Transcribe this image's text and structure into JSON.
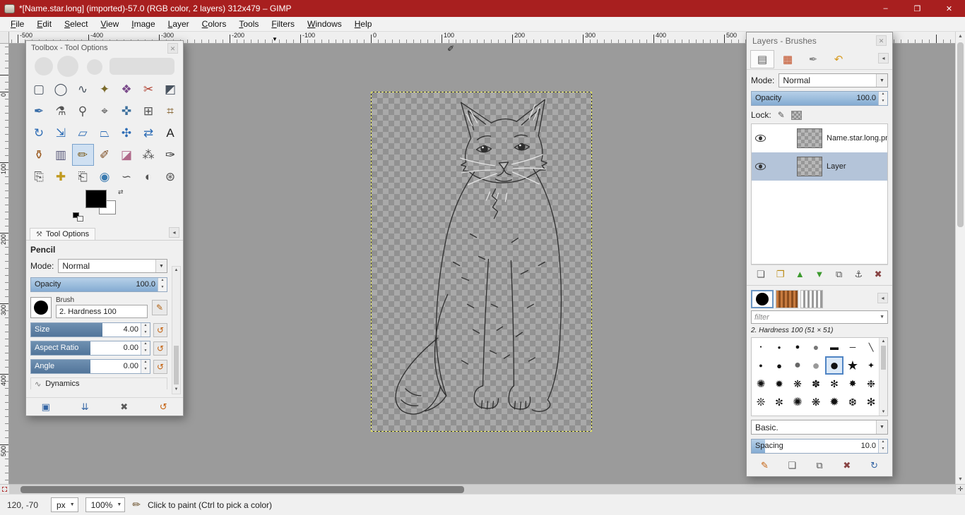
{
  "window": {
    "title": "*[Name.star.long] (imported)-57.0 (RGB color, 2 layers) 312x479 – GIMP",
    "minimize": "–",
    "maximize": "❐",
    "close": "✕"
  },
  "menubar": {
    "items": [
      "File",
      "Edit",
      "Select",
      "View",
      "Image",
      "Layer",
      "Colors",
      "Tools",
      "Filters",
      "Windows",
      "Help"
    ]
  },
  "rulers": {
    "horizontal_labels": [
      "-500",
      "-400",
      "-300",
      "-200",
      "-100",
      "0",
      "100",
      "200",
      "300",
      "400",
      "500"
    ],
    "vertical_labels": [
      "0",
      "100",
      "200",
      "300",
      "400",
      "500"
    ],
    "marker": "▼"
  },
  "toolbox": {
    "title": "Toolbox - Tool Options",
    "close": "✕",
    "tab_label": "Tool Options",
    "tab_icon": "⚒",
    "menu_arrow": "◂",
    "tool_name": "Pencil",
    "mode_label": "Mode:",
    "mode_value": "Normal",
    "opacity": {
      "label": "Opacity",
      "value": "100.0",
      "fill": 100
    },
    "brush": {
      "label": "Brush",
      "value": "2. Hardness 100"
    },
    "sliders": [
      {
        "label": "Size",
        "value": "4.00",
        "fill": 60
      },
      {
        "label": "Aspect Ratio",
        "value": "0.00",
        "fill": 50
      },
      {
        "label": "Angle",
        "value": "0.00",
        "fill": 50
      }
    ],
    "dynamics_label": "Dynamics",
    "dynamics_icon": "∿",
    "tools": [
      {
        "name": "rectangle-select-tool",
        "glyph": "▢",
        "color": "#4a5460"
      },
      {
        "name": "ellipse-select-tool",
        "glyph": "◯",
        "color": "#4a5460"
      },
      {
        "name": "free-select-tool",
        "glyph": "∿",
        "color": "#4a5460"
      },
      {
        "name": "fuzzy-select-tool",
        "glyph": "✦",
        "color": "#7a6a2a"
      },
      {
        "name": "select-by-color-tool",
        "glyph": "❖",
        "color": "#7a4a8a"
      },
      {
        "name": "scissors-select-tool",
        "glyph": "✂",
        "color": "#b04030"
      },
      {
        "name": "foreground-select-tool",
        "glyph": "◩",
        "color": "#4a5460"
      },
      {
        "name": "paths-tool",
        "glyph": "✒",
        "color": "#3a6ea8"
      },
      {
        "name": "color-picker-tool",
        "glyph": "⚗",
        "color": "#555555"
      },
      {
        "name": "zoom-tool",
        "glyph": "⚲",
        "color": "#555555"
      },
      {
        "name": "measure-tool",
        "glyph": "⌖",
        "color": "#555555"
      },
      {
        "name": "move-tool",
        "glyph": "✜",
        "color": "#3c6f9c"
      },
      {
        "name": "align-tool",
        "glyph": "⊞",
        "color": "#555555"
      },
      {
        "name": "crop-tool",
        "glyph": "⌗",
        "color": "#8a6a3a"
      },
      {
        "name": "rotate-tool",
        "glyph": "↻",
        "color": "#2d6cb5"
      },
      {
        "name": "scale-tool",
        "glyph": "⇲",
        "color": "#2d6cb5"
      },
      {
        "name": "shear-tool",
        "glyph": "▱",
        "color": "#2d6cb5"
      },
      {
        "name": "perspective-tool",
        "glyph": "⏢",
        "color": "#2d6cb5"
      },
      {
        "name": "unified-transform-tool",
        "glyph": "✣",
        "color": "#2d6cb5"
      },
      {
        "name": "flip-tool",
        "glyph": "⇄",
        "color": "#2d6cb5"
      },
      {
        "name": "text-tool",
        "glyph": "A",
        "color": "#222222"
      },
      {
        "name": "bucket-fill-tool",
        "glyph": "⚱",
        "color": "#9a5a20"
      },
      {
        "name": "gradient-tool",
        "glyph": "▥",
        "color": "#555577"
      },
      {
        "name": "pencil-tool",
        "glyph": "✏",
        "color": "#7a5a1a",
        "active": true
      },
      {
        "name": "paintbrush-tool",
        "glyph": "✐",
        "color": "#7a4a20"
      },
      {
        "name": "eraser-tool",
        "glyph": "◪",
        "color": "#b06a8a"
      },
      {
        "name": "airbrush-tool",
        "glyph": "⁂",
        "color": "#555555"
      },
      {
        "name": "ink-tool",
        "glyph": "✑",
        "color": "#333333"
      },
      {
        "name": "clone-tool",
        "glyph": "⎘",
        "color": "#555555"
      },
      {
        "name": "heal-tool",
        "glyph": "✚",
        "color": "#c09a20"
      },
      {
        "name": "perspective-clone-tool",
        "glyph": "⎗",
        "color": "#555555"
      },
      {
        "name": "blur-sharpen-tool",
        "glyph": "◉",
        "color": "#3a7ab0"
      },
      {
        "name": "smudge-tool",
        "glyph": "∽",
        "color": "#555555"
      },
      {
        "name": "dodge-burn-tool",
        "glyph": "◐",
        "color": "#555555"
      },
      {
        "name": "mypaint-brush-tool",
        "glyph": "⊛",
        "color": "#555555"
      }
    ],
    "bottom_buttons": [
      {
        "name": "save-tool-preset-button",
        "glyph": "▣",
        "color": "#3465a4"
      },
      {
        "name": "restore-tool-preset-button",
        "glyph": "⇊",
        "color": "#3465a4"
      },
      {
        "name": "delete-tool-preset-button",
        "glyph": "✖",
        "color": "#5a5a5a"
      },
      {
        "name": "reset-tool-options-button",
        "glyph": "↺",
        "color": "#c4600c"
      }
    ]
  },
  "layers_panel": {
    "title": "Layers - Brushes",
    "close": "✕",
    "menu_arrow": "◂",
    "tabs": [
      {
        "name": "tab-layers",
        "glyph": "▤",
        "color": "#555555",
        "active": true
      },
      {
        "name": "tab-channels",
        "glyph": "▦",
        "color": "#c0491f"
      },
      {
        "name": "tab-paths",
        "glyph": "✒",
        "color": "#8a8a8a"
      },
      {
        "name": "tab-undo-history",
        "glyph": "↶",
        "color": "#d79b20"
      }
    ],
    "mode_label": "Mode:",
    "mode_value": "Normal",
    "opacity": {
      "label": "Opacity",
      "value": "100.0",
      "fill": 100
    },
    "lock_label": "Lock:",
    "layers": [
      {
        "name": "Name.star.long.png",
        "selected": false
      },
      {
        "name": "Layer",
        "selected": true
      }
    ],
    "buttons": [
      {
        "name": "new-layer-button",
        "glyph": "❏",
        "color": "#555555"
      },
      {
        "name": "new-layer-group-button",
        "glyph": "❐",
        "color": "#b8860b"
      },
      {
        "name": "raise-layer-button",
        "glyph": "▲",
        "color": "#3c9a2e"
      },
      {
        "name": "lower-layer-button",
        "glyph": "▼",
        "color": "#3c9a2e"
      },
      {
        "name": "duplicate-layer-button",
        "glyph": "⧉",
        "color": "#555555"
      },
      {
        "name": "anchor-layer-button",
        "glyph": "⚓",
        "color": "#555555"
      },
      {
        "name": "delete-layer-button",
        "glyph": "✖",
        "color": "#884444"
      }
    ]
  },
  "brushes_panel": {
    "menu_arrow": "◂",
    "filter_placeholder": "filter",
    "brush_info": "2. Hardness 100 (51 × 51)",
    "tag_value": "Basic.",
    "spacing": {
      "label": "Spacing",
      "value": "10.0",
      "fill": 10
    },
    "brushes": [
      {
        "g": "●",
        "s": 5
      },
      {
        "g": "●",
        "s": 8
      },
      {
        "g": "●",
        "s": 11
      },
      {
        "g": "●",
        "s": 14,
        "c": "#777777"
      },
      {
        "g": "▬",
        "s": 12
      },
      {
        "g": "─",
        "s": 12
      },
      {
        "g": "╲",
        "s": 11
      },
      {
        "g": "●",
        "s": 9
      },
      {
        "g": "●",
        "s": 13
      },
      {
        "g": "●",
        "s": 16,
        "c": "#666666"
      },
      {
        "g": "●",
        "s": 18,
        "c": "#999999"
      },
      {
        "g": "●",
        "s": 22,
        "sel": true
      },
      {
        "g": "★",
        "s": 18
      },
      {
        "g": "✦",
        "s": 12
      },
      {
        "g": "✺",
        "s": 15
      },
      {
        "g": "✹",
        "s": 14
      },
      {
        "g": "❋",
        "s": 14
      },
      {
        "g": "✽",
        "s": 14
      },
      {
        "g": "✻",
        "s": 14
      },
      {
        "g": "✸",
        "s": 13
      },
      {
        "g": "❉",
        "s": 14
      },
      {
        "g": "❊",
        "s": 15
      },
      {
        "g": "✼",
        "s": 14
      },
      {
        "g": "✺",
        "s": 16
      },
      {
        "g": "❋",
        "s": 15
      },
      {
        "g": "✹",
        "s": 16
      },
      {
        "g": "❆",
        "s": 14
      },
      {
        "g": "✻",
        "s": 15
      }
    ],
    "buttons": [
      {
        "name": "edit-brush-button",
        "glyph": "✎",
        "color": "#c4600c"
      },
      {
        "name": "new-brush-button",
        "glyph": "❏",
        "color": "#555555"
      },
      {
        "name": "duplicate-brush-button",
        "glyph": "⧉",
        "color": "#555555"
      },
      {
        "name": "delete-brush-button",
        "glyph": "✖",
        "color": "#884444"
      },
      {
        "name": "refresh-brushes-button",
        "glyph": "↻",
        "color": "#3465a4"
      }
    ]
  },
  "statusbar": {
    "position": "120, -70",
    "units": "px",
    "zoom": "100%",
    "tool_icon": "✏",
    "message": "Click to paint (Ctrl to pick a color)"
  }
}
